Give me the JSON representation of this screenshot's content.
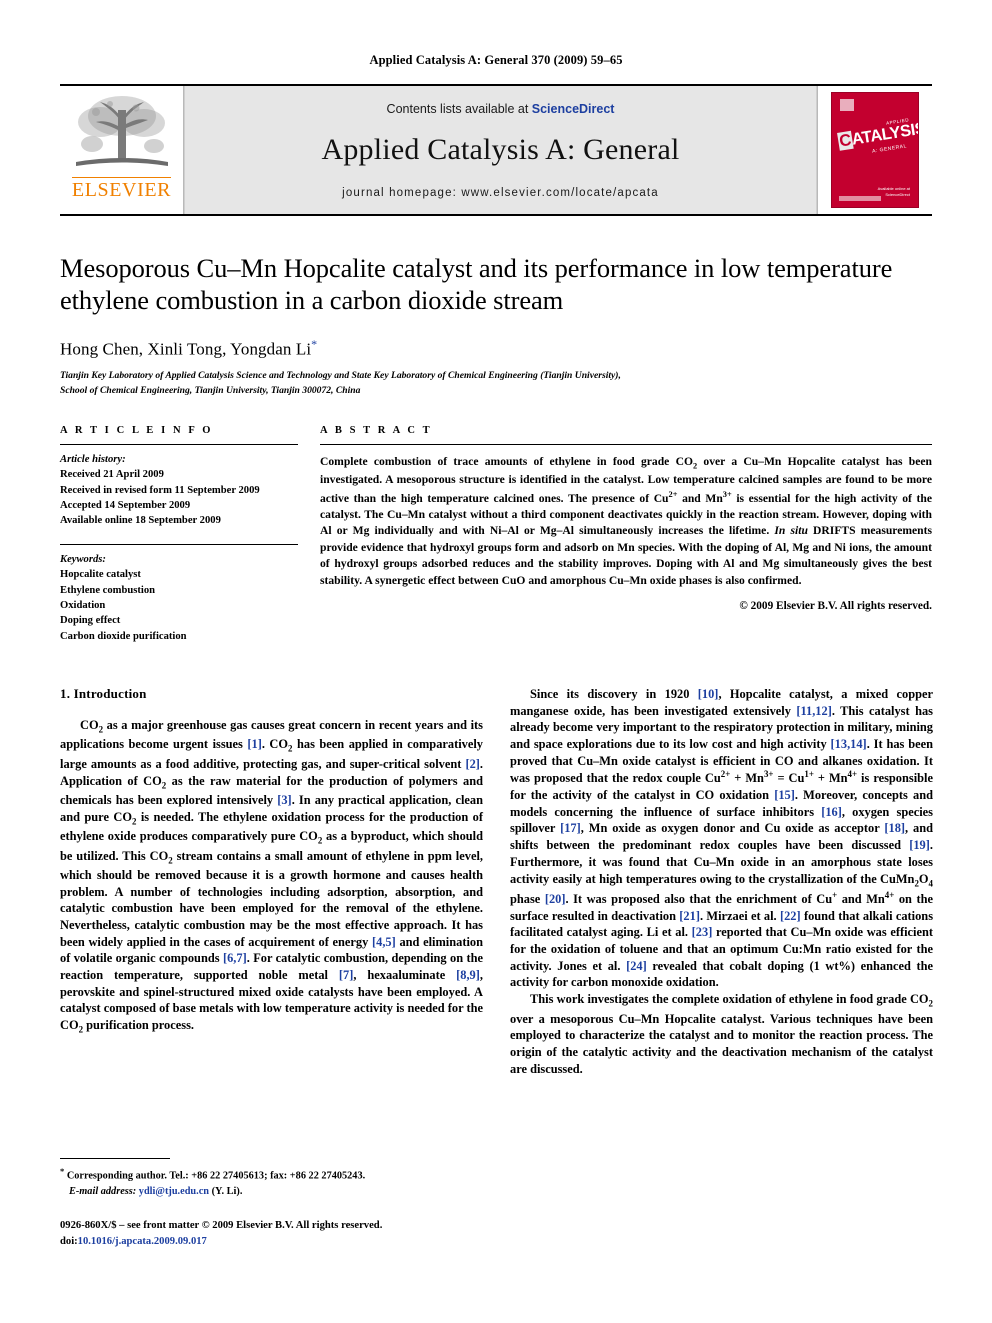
{
  "running_head": "Applied Catalysis A: General 370 (2009) 59–65",
  "masthead": {
    "publisher_name": "ELSEVIER",
    "contents_prefix": "Contents lists available at ",
    "contents_link": "ScienceDirect",
    "journal_title": "Applied Catalysis A: General",
    "homepage": "journal homepage: www.elsevier.com/locate/apcata",
    "cover": {
      "applied_label": "APPLIED",
      "main_word_first": "C",
      "main_word_rest": "ATALYSIS",
      "sub_label": "A: GENERAL",
      "footer_line1": "Available online at",
      "footer_line2": "ScienceDirect",
      "color": "#c3002f"
    }
  },
  "article": {
    "title": "Mesoporous Cu–Mn Hopcalite catalyst and its performance in low temperature ethylene combustion in a carbon dioxide stream",
    "authors": "Hong Chen, Xinli Tong, Yongdan Li",
    "corresponding_marker": "*",
    "affiliation_line1": "Tianjin Key Laboratory of Applied Catalysis Science and Technology and State Key Laboratory of Chemical Engineering (Tianjin University),",
    "affiliation_line2": "School of Chemical Engineering, Tianjin University, Tianjin 300072, China"
  },
  "article_info": {
    "heading": "A R T I C L E   I N F O",
    "history_label": "Article history:",
    "history": [
      "Received 21 April 2009",
      "Received in revised form 11 September 2009",
      "Accepted 14 September 2009",
      "Available online 18 September 2009"
    ],
    "keywords_label": "Keywords:",
    "keywords": [
      "Hopcalite catalyst",
      "Ethylene combustion",
      "Oxidation",
      "Doping effect",
      "Carbon dioxide purification"
    ]
  },
  "abstract": {
    "heading": "A B S T R A C T",
    "part1": "Complete combustion of trace amounts of ethylene in food grade CO",
    "part1b": "2",
    "part1c": " over a Cu–Mn Hopcalite catalyst has been investigated. A mesoporous structure is identified in the catalyst. Low temperature calcined samples are found to be more active than the high temperature calcined ones. The presence of Cu",
    "sup1": "2+",
    "part2": " and Mn",
    "sup2": "3+",
    "part3": " is essential for the high activity of the catalyst. The Cu–Mn catalyst without a third component deactivates quickly in the reaction stream. However, doping with Al or Mg individually and with Ni–Al or Mg–Al simultaneously increases the lifetime. ",
    "italic1": "In situ",
    "part4": " DRIFTS measurements provide evidence that hydroxyl groups form and adsorb on Mn species. With the doping of Al, Mg and Ni ions, the amount of hydroxyl groups adsorbed reduces and the stability improves. Doping with Al and Mg simultaneously gives the best stability. A synergetic effect between CuO and amorphous Cu–Mn oxide phases is also confirmed.",
    "copyright": "© 2009 Elsevier B.V. All rights reserved."
  },
  "introduction": {
    "heading": "1. Introduction",
    "left_p1_a": "CO",
    "left_p1_sub": "2",
    "left_p1_b": " as a major greenhouse gas causes great concern in recent years and its applications become urgent issues ",
    "ref1": "[1]",
    "left_p1_c": ". CO",
    "left_p1_d": " has been applied in comparatively large amounts as a food additive, protecting gas, and super-critical solvent ",
    "ref2": "[2]",
    "left_p1_e": ". Application of CO",
    "left_p1_f": " as the raw material for the production of polymers and chemicals has been explored intensively ",
    "ref3": "[3]",
    "left_p1_g": ". In any practical application, clean and pure CO",
    "left_p1_h": " is needed. The ethylene oxidation process for the production of ethylene oxide produces comparatively pure CO",
    "left_p1_i": " as a byproduct, which should be utilized. This CO",
    "left_p1_j": " stream contains a small amount of ethylene in ppm level, which should be removed because it is a growth hormone and causes health problem. A number of technologies including adsorption, absorption, and catalytic combustion have been employed for the removal of the ethylene. Nevertheless, catalytic combustion may be the most effective approach. It has been widely applied in the cases of acquirement of energy ",
    "ref45": "[4,5]",
    "left_p1_k": " and elimination of volatile organic compounds ",
    "ref67": "[6,7]",
    "left_p1_l": ". For catalytic combustion, depending on the reaction temperature, supported noble metal ",
    "ref7": "[7]",
    "left_p1_m": ", hexaaluminate ",
    "ref89": "[8,9]",
    "left_p1_n": ", perovskite and spinel-structured mixed oxide catalysts have been employed. A catalyst composed of base metals with low temperature activity is needed for the CO",
    "left_p1_o": " purification process.",
    "right_p1_a": "Since its discovery in 1920 ",
    "ref10": "[10]",
    "right_p1_b": ", Hopcalite catalyst, a mixed copper manganese oxide, has been investigated extensively ",
    "ref1112": "[11,12]",
    "right_p1_c": ". This catalyst has already become very important to the respiratory protection in military, mining and space explorations due to its low cost and high activity ",
    "ref1314": "[13,14]",
    "right_p1_d": ". It has been proved that Cu–Mn oxide catalyst is efficient in CO and alkanes oxidation. It was proposed that the redox couple Cu",
    "sup_cu2": "2+",
    "right_p1_e": " + Mn",
    "sup_mn3": "3+",
    "right_p1_f": " = Cu",
    "sup_cu1": "1+",
    "right_p1_g": " + Mn",
    "sup_mn4": "4+",
    "right_p1_h": " is responsible for the activity of the catalyst in CO oxidation ",
    "ref15": "[15]",
    "right_p1_i": ". Moreover, concepts and models concerning the influence of surface inhibitors ",
    "ref16": "[16]",
    "right_p1_j": ", oxygen species spillover ",
    "ref17": "[17]",
    "right_p1_k": ", Mn oxide as oxygen donor and Cu oxide as acceptor ",
    "ref18": "[18]",
    "right_p1_l": ", and shifts between the predominant redox couples have been discussed ",
    "ref19": "[19]",
    "right_p1_m": ". Furthermore, it was found that Cu–Mn oxide in an amorphous state loses activity easily at high temperatures owing to the crystallization of the CuMn",
    "sub_mn2": "2",
    "right_p1_n": "O",
    "sub_o4": "4",
    "right_p1_o": " phase ",
    "ref20": "[20]",
    "right_p1_p": ". It was proposed also that the enrichment of Cu",
    "sup_cuplus": "+",
    "right_p1_q": " and Mn",
    "sup_mn4b": "4+",
    "right_p1_r": " on the surface resulted in deactivation ",
    "ref21": "[21]",
    "right_p1_s": ". Mirzaei et al. ",
    "ref22": "[22]",
    "right_p1_t": " found that alkali cations facilitated catalyst aging. Li et al. ",
    "ref23": "[23]",
    "right_p1_u": " reported that Cu–Mn oxide was efficient for the oxidation of toluene and that an optimum Cu:Mn ratio existed for the activity. Jones et al. ",
    "ref24": "[24]",
    "right_p1_v": " revealed that cobalt doping (1 wt%) enhanced the activity for carbon monoxide oxidation.",
    "right_p2_a": "This work investigates the complete oxidation of ethylene in food grade CO",
    "right_p2_sub": "2",
    "right_p2_b": " over a mesoporous Cu–Mn Hopcalite catalyst. Various techniques have been employed to characterize the catalyst and to monitor the reaction process. The origin of the catalytic activity and the deactivation mechanism of the catalyst are discussed."
  },
  "footnote": {
    "marker": "*",
    "corresponding": " Corresponding author. Tel.: +86 22 27405613; fax: +86 22 27405243.",
    "email_label": "E-mail address:",
    "email": "ydli@tju.edu.cn",
    "email_suffix": " (Y. Li).",
    "issn_line": "0926-860X/$ – see front matter © 2009 Elsevier B.V. All rights reserved.",
    "doi_label": "doi:",
    "doi_value": "10.1016/j.apcata.2009.09.017"
  }
}
